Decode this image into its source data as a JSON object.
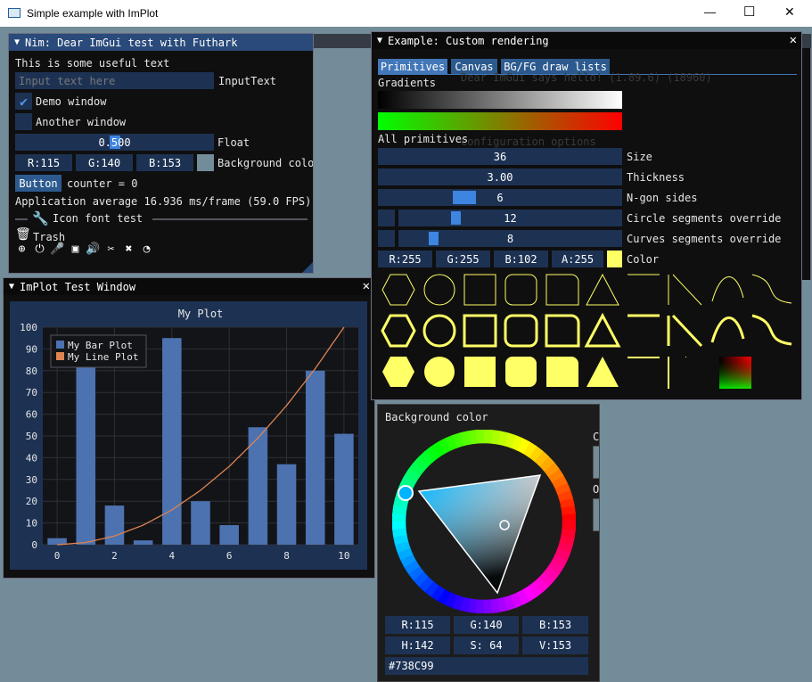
{
  "os_window": {
    "title": "Simple example with ImPlot",
    "minimize": "—",
    "maximize": "☐",
    "close": "✕"
  },
  "colors": {
    "background": "#738C99",
    "title_active": "#294A7A",
    "frame": "#1D3253",
    "button": "#2C5A8E",
    "accent": "#4277B8",
    "primitive_yellow": "#FFFF66",
    "bar": "#4C72B0",
    "line": "#DD8452"
  },
  "nim_window": {
    "title": "Nim: Dear ImGui test with Futhark",
    "text": "This is some useful text",
    "input_placeholder": "Input text here",
    "input_label": "InputText",
    "demo_window": "Demo window",
    "another_window": "Another window",
    "float_value": "0.500",
    "float_label": "Float",
    "r": "R:115",
    "g": "G:140",
    "b": "B:153",
    "bg_label": "Background colo",
    "button": "Button",
    "counter": "counter = 0",
    "fps": "Application average 16.936 ms/frame (59.0 FPS)",
    "icon_font_test": "Icon font test",
    "trash": "Trash",
    "icons": [
      "search-plus-icon",
      "power-icon",
      "microphone-icon",
      "chip-icon",
      "volume-icon",
      "scissors-icon",
      "tools-icon",
      "satellite-icon"
    ]
  },
  "implot_window": {
    "title": "ImPlot Test Window",
    "legend": [
      "My Bar Plot",
      "My Line Plot"
    ]
  },
  "chart_data": {
    "type": "bar",
    "title": "My Plot",
    "xlabel": "",
    "ylabel": "",
    "xlim": [
      -0.5,
      10.5
    ],
    "ylim": [
      0,
      100
    ],
    "xticks": [
      0,
      2,
      4,
      6,
      8,
      10
    ],
    "yticks": [
      0,
      10,
      20,
      30,
      40,
      50,
      60,
      70,
      80,
      90,
      100
    ],
    "grid": true,
    "legend_position": "top-left",
    "series": [
      {
        "name": "My Bar Plot",
        "type": "bar",
        "x": [
          0,
          1,
          2,
          3,
          4,
          5,
          6,
          7,
          8,
          9,
          10
        ],
        "values": [
          3,
          82,
          18,
          2,
          95,
          20,
          9,
          54,
          37,
          80,
          51
        ]
      },
      {
        "name": "My Line Plot",
        "type": "line",
        "x": [
          0,
          1,
          2,
          3,
          4,
          5,
          6,
          7,
          8,
          9,
          10
        ],
        "values": [
          0,
          1,
          4,
          9,
          16,
          25,
          36,
          49,
          64,
          81,
          100
        ]
      }
    ]
  },
  "custom_window": {
    "title": "Example: Custom rendering",
    "close": "✕",
    "tabs": [
      "Primitives",
      "Canvas",
      "BG/FG draw lists"
    ],
    "gradients": "Gradients",
    "all_primitives": "All primitives",
    "size_value": "36",
    "size_label": "Size",
    "thickness_value": "3.00",
    "thickness_label": "Thickness",
    "ngon_value": "6",
    "ngon_label": "N-gon sides",
    "circle_value": "12",
    "circle_label": "Circle segments override",
    "curves_value": "8",
    "curves_label": "Curves segments override",
    "color_r": "R:255",
    "color_g": "G:255",
    "color_b": "B:102",
    "color_a": "A:255",
    "color_label": "Color",
    "behind_text_1": "Dear ImGui says hello! (1.89.6) (18960)",
    "behind_text_2": "Configuration options"
  },
  "picker": {
    "title": "Background color",
    "current": "Current",
    "original": "Original",
    "r": "R:115",
    "g": "G:140",
    "b": "B:153",
    "h": "H:142",
    "s": "S: 64",
    "v": "V:153",
    "hex": "#738C99"
  }
}
